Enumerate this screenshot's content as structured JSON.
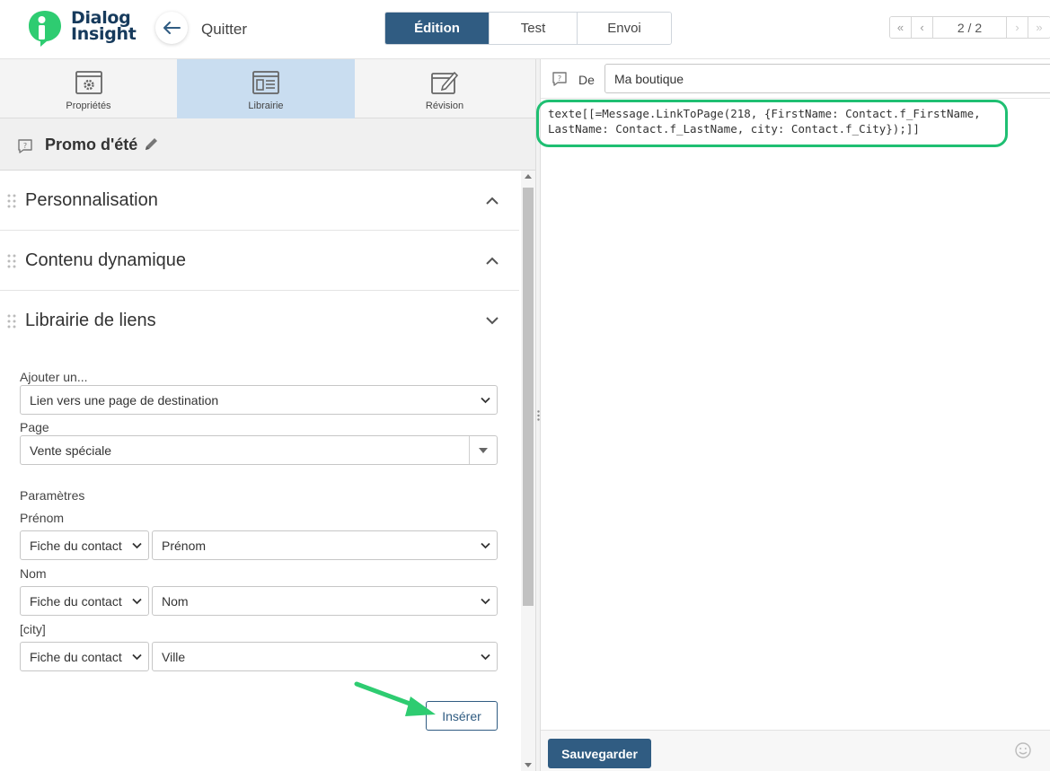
{
  "logo": {
    "line1": "Dialog",
    "line2": "Insight"
  },
  "header": {
    "back_label": "Quitter",
    "modes": [
      {
        "label": "Édition",
        "active": true
      },
      {
        "label": "Test",
        "active": false
      },
      {
        "label": "Envoi",
        "active": false
      }
    ],
    "pager": {
      "first": "«",
      "prev": "‹",
      "current": "2 / 2",
      "next": "›",
      "last": "»"
    }
  },
  "side_tabs": [
    {
      "label": "Propriétés",
      "icon": "settings-window-icon",
      "active": false
    },
    {
      "label": "Librairie",
      "icon": "library-layout-icon",
      "active": true
    },
    {
      "label": "Révision",
      "icon": "revision-edit-icon",
      "active": false
    }
  ],
  "document_title": "Promo d'été",
  "sections": [
    {
      "title": "Personnalisation",
      "state": "collapsed"
    },
    {
      "title": "Contenu dynamique",
      "state": "collapsed"
    },
    {
      "title": "Librairie de liens",
      "state": "expanded"
    }
  ],
  "link_form": {
    "add_label": "Ajouter un...",
    "add_value": "Lien vers une page de destination",
    "page_label": "Page",
    "page_value": "Vente spéciale",
    "params_label": "Paramètres",
    "params": [
      {
        "label": "Prénom",
        "source": "Fiche du contact",
        "field": "Prénom"
      },
      {
        "label": "Nom",
        "source": "Fiche du contact",
        "field": "Nom"
      },
      {
        "label": "[city]",
        "source": "Fiche du contact",
        "field": "Ville"
      }
    ],
    "insert_label": "Insérer"
  },
  "editor": {
    "from_label": "De",
    "from_value": "Ma boutique",
    "code_line1": "texte[[=Message.LinkToPage(218, {FirstName: Contact.f_FirstName,",
    "code_line2": "LastName: Contact.f_LastName, city: Contact.f_City});]]",
    "save_label": "Sauvegarder"
  },
  "colors": {
    "primary": "#305c82",
    "active_tab_bg": "#c9ddf0",
    "highlight_green": "#1fbf72",
    "logo_green": "#2ecc71",
    "logo_navy": "#163a5c"
  }
}
